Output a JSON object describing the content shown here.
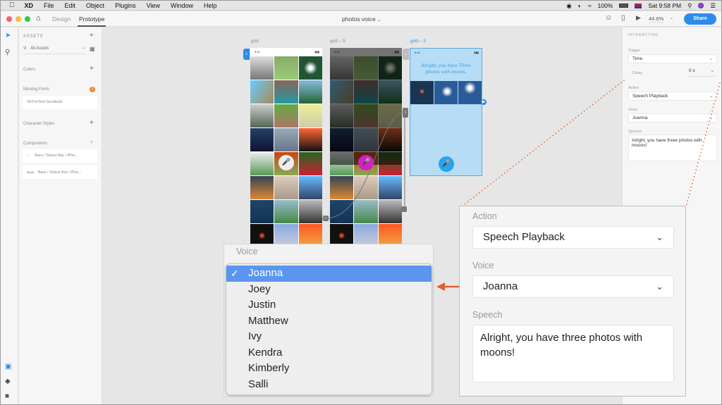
{
  "menubar": {
    "apple": "",
    "items": [
      "XD",
      "File",
      "Edit",
      "Object",
      "Plugins",
      "View",
      "Window",
      "Help"
    ],
    "battery": "100%",
    "clock": "Sat 9:58 PM"
  },
  "titlebar": {
    "tabs": [
      {
        "label": "Design",
        "active": false
      },
      {
        "label": "Prototype",
        "active": true
      }
    ],
    "document_title": "photos voice",
    "zoom_level": "44.6%",
    "share_label": "Share"
  },
  "assets": {
    "header": "ASSETS",
    "filter": "All Assets",
    "colors_label": "Colors",
    "missing_fonts_label": "Missing Fonts",
    "missing_font": "SFProText-Semibold",
    "character_styles_label": "Character Styles",
    "components_label": "Components",
    "components": [
      {
        "thumb": "- -",
        "name": "Bars / Status Bar / iPho..."
      },
      {
        "thumb": "09:41",
        "name": "Bars / Status Bar / iPho..."
      }
    ]
  },
  "canvas": {
    "artboards": [
      {
        "name": "grid",
        "time": "9:41",
        "highlighted": false
      },
      {
        "name": "grid – 5",
        "time": "9:41",
        "highlighted": false
      },
      {
        "name": "grid – 3",
        "time": "9:41",
        "highlighted": true,
        "message": "Alright, you have Three photos with moons."
      }
    ],
    "accent": "#2d8ceb",
    "mic_active_color": "#d61ec3"
  },
  "inspector": {
    "header": "INTERACTION",
    "trigger_label": "Trigger",
    "trigger_value": "Time",
    "delay_label": "Delay",
    "delay_value": "0 s",
    "action_label": "Action",
    "action_value": "Speech Playback",
    "voice_label": "Voice",
    "voice_value": "Joanna",
    "speech_label": "Speech",
    "speech_value": "Alright, you have three photos with moons!"
  },
  "voice_dropdown": {
    "label": "Voice",
    "selected": "Joanna",
    "options": [
      "Joanna",
      "Joey",
      "Justin",
      "Matthew",
      "Ivy",
      "Kendra",
      "Kimberly",
      "Salli"
    ]
  },
  "zoom_callout": {
    "action_label": "Action",
    "action_value": "Speech Playback",
    "voice_label": "Voice",
    "voice_value": "Joanna",
    "speech_label": "Speech",
    "speech_value": "Alright, you have three photos with moons!"
  },
  "annotation_color": "#e0622a"
}
